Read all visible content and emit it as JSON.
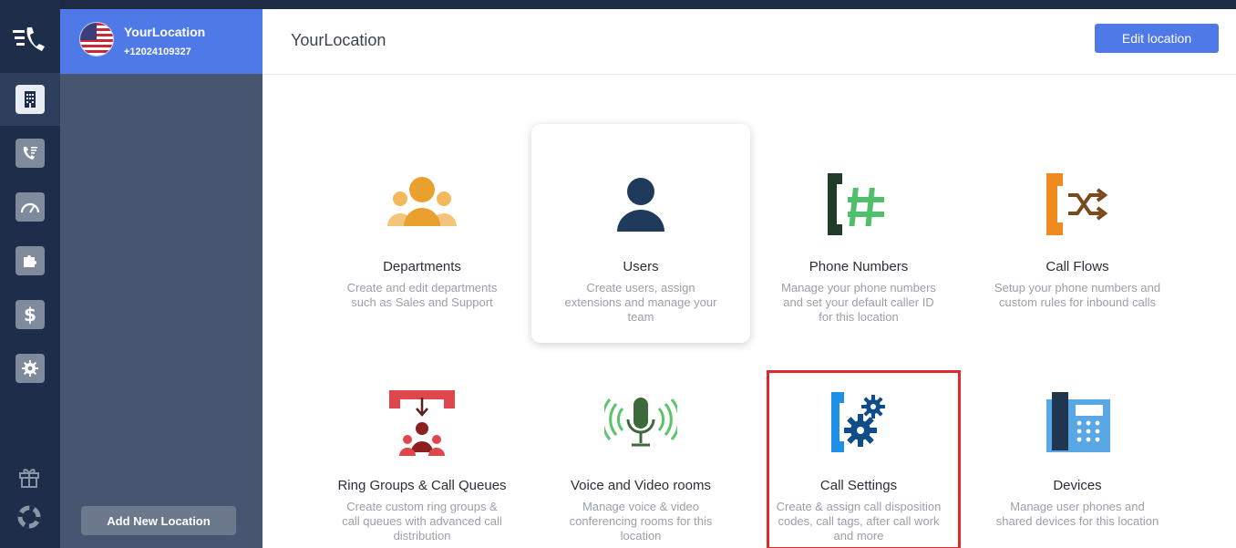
{
  "location": {
    "name": "YourLocation",
    "phone": "+12024109327"
  },
  "sidebar": {
    "add_location_label": "Add New Location"
  },
  "rail": {
    "items": [
      "building-icon",
      "call-log-icon",
      "dashboard-icon",
      "integrations-icon",
      "billing-icon",
      "settings-icon",
      "gift-icon",
      "support-icon"
    ]
  },
  "header": {
    "title": "YourLocation",
    "edit_label": "Edit location"
  },
  "tiles": [
    {
      "title": "Departments",
      "desc": "Create and edit departments such as Sales and Support"
    },
    {
      "title": "Users",
      "desc": "Create users, assign extensions and manage your team"
    },
    {
      "title": "Phone Numbers",
      "desc": "Manage your phone numbers and set your default caller ID for this location"
    },
    {
      "title": "Call Flows",
      "desc": "Setup your phone numbers and custom rules for inbound calls"
    },
    {
      "title": "Ring Groups & Call Queues",
      "desc": "Create custom ring groups & call queues with advanced call distribution"
    },
    {
      "title": "Voice and Video rooms",
      "desc": "Manage voice & video conferencing rooms for this location"
    },
    {
      "title": "Call Settings",
      "desc": "Create & assign call disposition codes, call tags, after call work and more"
    },
    {
      "title": "Devices",
      "desc": "Manage user phones and shared devices for this location"
    }
  ],
  "colors": {
    "accent": "#4e79e7",
    "rail": "#1e2e4a",
    "sidebar": "#475570",
    "highlight": "#dd2a2f"
  }
}
